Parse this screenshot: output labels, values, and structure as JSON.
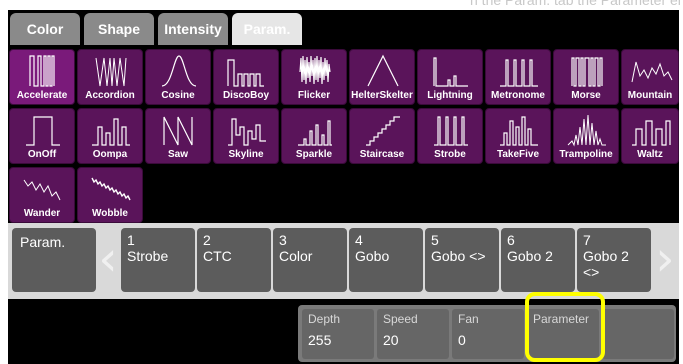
{
  "top_partial_text": "n the Param. tab the Parameter encoder",
  "tabs": [
    {
      "label": "Color",
      "active": false
    },
    {
      "label": "Shape",
      "active": false
    },
    {
      "label": "Intensity",
      "active": false
    },
    {
      "label": "Param.",
      "active": true
    }
  ],
  "effects": [
    {
      "label": "Accelerate",
      "icon": "accelerate-icon",
      "selected": true
    },
    {
      "label": "Accordion",
      "icon": "accordion-icon"
    },
    {
      "label": "Cosine",
      "icon": "cosine-icon"
    },
    {
      "label": "DiscoBoy",
      "icon": "discoboy-icon"
    },
    {
      "label": "Flicker",
      "icon": "flicker-icon"
    },
    {
      "label": "HelterSkelter",
      "icon": "helterskelter-icon"
    },
    {
      "label": "Lightning",
      "icon": "lightning-icon"
    },
    {
      "label": "Metronome",
      "icon": "metronome-icon"
    },
    {
      "label": "Morse",
      "icon": "morse-icon"
    },
    {
      "label": "Mountain",
      "icon": "mountain-icon"
    },
    {
      "label": "OnOff",
      "icon": "onoff-icon"
    },
    {
      "label": "Oompa",
      "icon": "oompa-icon"
    },
    {
      "label": "Saw",
      "icon": "saw-icon"
    },
    {
      "label": "Skyline",
      "icon": "skyline-icon"
    },
    {
      "label": "Sparkle",
      "icon": "sparkle-icon"
    },
    {
      "label": "Staircase",
      "icon": "staircase-icon"
    },
    {
      "label": "Strobe",
      "icon": "strobe-icon"
    },
    {
      "label": "TakeFive",
      "icon": "takefive-icon"
    },
    {
      "label": "Trampoline",
      "icon": "trampoline-icon"
    },
    {
      "label": "Waltz",
      "icon": "waltz-icon"
    },
    {
      "label": "Wander",
      "icon": "wander-icon"
    },
    {
      "label": "Wobble",
      "icon": "wobble-icon"
    }
  ],
  "param_row": {
    "title": "Param.",
    "left_chevron": "‹",
    "right_chevron": "›",
    "params": [
      {
        "num": "1",
        "name": "Strobe"
      },
      {
        "num": "2",
        "name": "CTC"
      },
      {
        "num": "3",
        "name": "Color"
      },
      {
        "num": "4",
        "name": "Gobo"
      },
      {
        "num": "5",
        "name": "Gobo <>"
      },
      {
        "num": "6",
        "name": "Gobo 2"
      },
      {
        "num": "7",
        "name": "Gobo 2 <>"
      }
    ]
  },
  "encoders": [
    {
      "label": "Depth",
      "value": "255"
    },
    {
      "label": "Speed",
      "value": "20"
    },
    {
      "label": "Fan",
      "value": "0"
    },
    {
      "label": "Parameter",
      "value": ""
    },
    {
      "label": "",
      "value": ""
    }
  ],
  "colors": {
    "effect_bg": "#5a145a",
    "highlight": "#ffff00"
  }
}
